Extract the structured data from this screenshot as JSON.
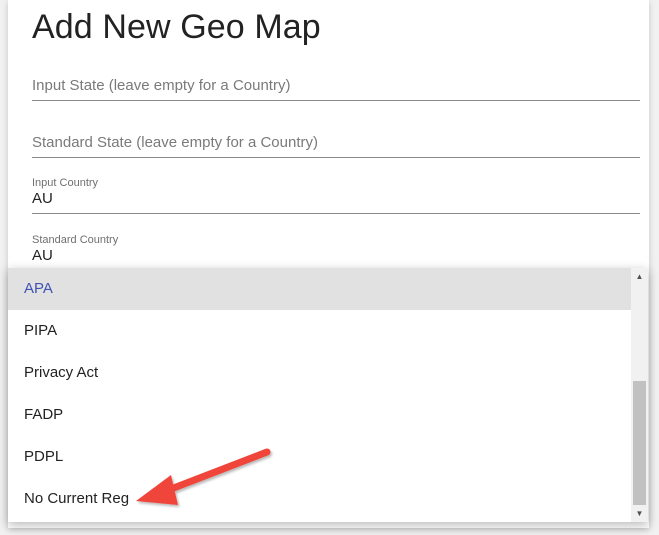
{
  "dialog": {
    "title": "Add New Geo Map",
    "fields": {
      "input_state": {
        "placeholder": "Input State (leave empty for a Country)"
      },
      "standard_state": {
        "placeholder": "Standard State (leave empty for a Country)"
      },
      "input_country": {
        "label": "Input Country",
        "value": "AU"
      },
      "standard_country": {
        "label": "Standard Country",
        "value": "AU"
      }
    }
  },
  "dropdown": {
    "options": [
      {
        "label": "APA",
        "selected": true
      },
      {
        "label": "PIPA",
        "selected": false
      },
      {
        "label": "Privacy Act",
        "selected": false
      },
      {
        "label": "FADP",
        "selected": false
      },
      {
        "label": "PDPL",
        "selected": false
      },
      {
        "label": "No Current Reg",
        "selected": false
      }
    ],
    "scrollbar": {
      "up_icon": "arrow-up-icon",
      "down_icon": "arrow-down-icon"
    }
  },
  "annotation": {
    "color": "#f0443a",
    "icon": "red-arrow-icon"
  },
  "colors": {
    "selected_text": "#3f51b5",
    "selected_background": "#e1e1e1"
  }
}
